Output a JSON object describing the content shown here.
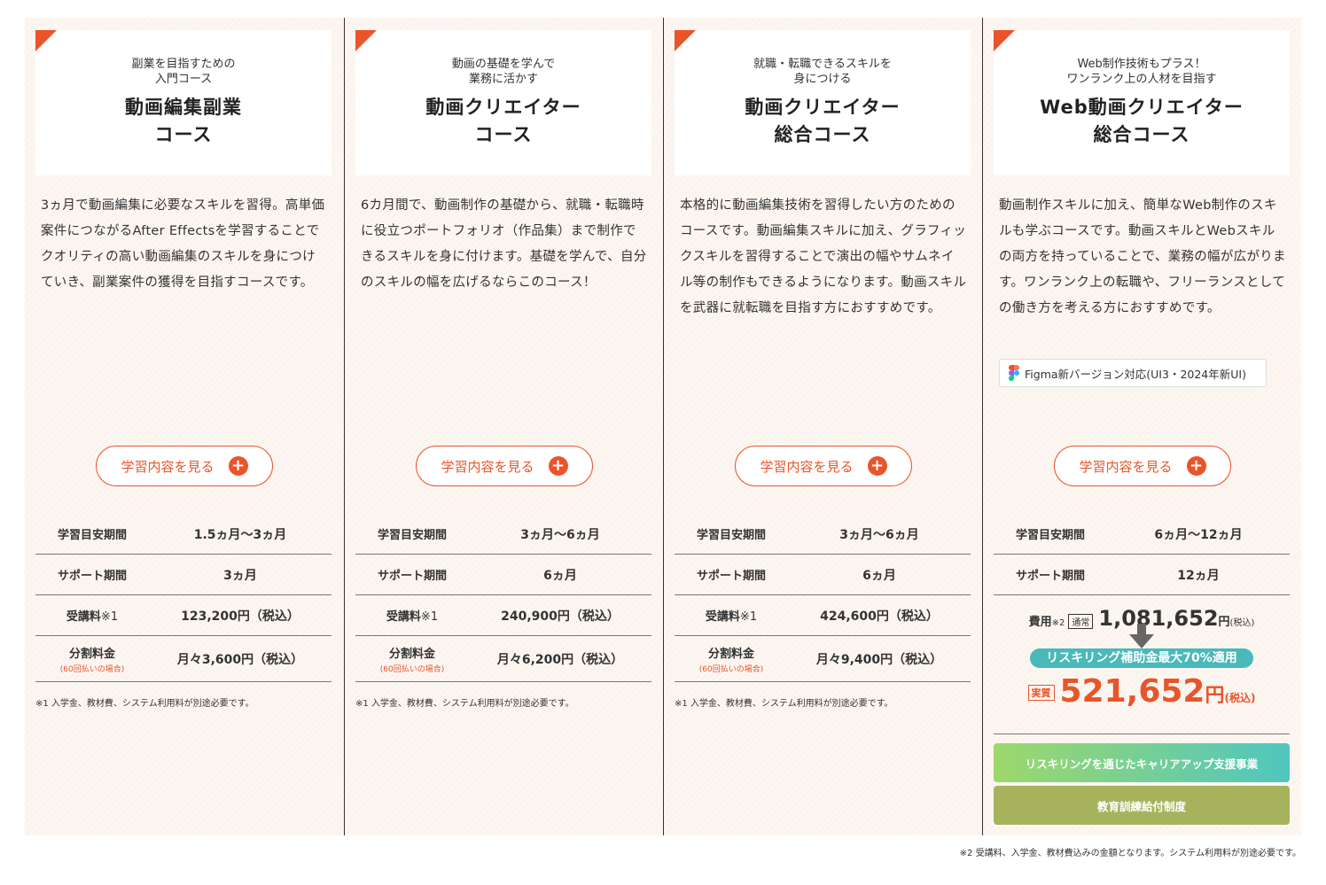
{
  "courses": [
    {
      "subtitle": "副業を目指すための\n入門コース",
      "title": "動画編集副業\nコース",
      "description": "3ヵ月で動画編集に必要なスキルを習得。高単価案件につながるAfter Effectsを学習することでクオリティの高い動画編集のスキルを身につけていき、副業案件の獲得を目指すコースです。",
      "button_label": "学習内容を見る",
      "period_label": "学習目安期間",
      "period_value": "1.5ヵ月〜3ヵ月",
      "support_label": "サポート期間",
      "support_value": "3ヵ月",
      "fee_label": "受講料",
      "fee_mark": "※1",
      "fee_value": "123,200円（税込）",
      "installment_label": "分割料金",
      "installment_note": "(60回払いの場合)",
      "installment_value": "月々3,600円（税込）",
      "note": "※1 入学金、教材費、システム利用料が別途必要です。"
    },
    {
      "subtitle": "動画の基礎を学んで\n業務に活かす",
      "title": "動画クリエイター\nコース",
      "description": "6カ月間で、動画制作の基礎から、就職・転職時に役立つポートフォリオ（作品集）まで制作できるスキルを身に付けます。基礎を学んで、自分のスキルの幅を広げるならこのコース！",
      "button_label": "学習内容を見る",
      "period_label": "学習目安期間",
      "period_value": "3ヵ月〜6ヵ月",
      "support_label": "サポート期間",
      "support_value": "6ヵ月",
      "fee_label": "受講料",
      "fee_mark": "※1",
      "fee_value": "240,900円（税込）",
      "installment_label": "分割料金",
      "installment_note": "(60回払いの場合)",
      "installment_value": "月々6,200円（税込）",
      "note": "※1 入学金、教材費、システム利用料が別途必要です。"
    },
    {
      "subtitle": "就職・転職できるスキルを\n身につける",
      "title": "動画クリエイター\n総合コース",
      "description": "本格的に動画編集技術を習得したい方のためのコースです。動画編集スキルに加え、グラフィックスキルを習得することで演出の幅やサムネイル等の制作もできるようになります。動画スキルを武器に就転職を目指す方におすすめです。",
      "button_label": "学習内容を見る",
      "period_label": "学習目安期間",
      "period_value": "3ヵ月〜6ヵ月",
      "support_label": "サポート期間",
      "support_value": "6ヵ月",
      "fee_label": "受講料",
      "fee_mark": "※1",
      "fee_value": "424,600円（税込）",
      "installment_label": "分割料金",
      "installment_note": "(60回払いの場合)",
      "installment_value": "月々9,400円（税込）",
      "note": "※1 入学金、教材費、システム利用料が別途必要です。"
    },
    {
      "subtitle": "Web制作技術もプラス！\nワンランク上の人材を目指す",
      "title": "Web動画クリエイター\n総合コース",
      "description": "動画制作スキルに加え、簡単なWeb制作のスキルも学ぶコースです。動画スキルとWebスキルの両方を持っていることで、業務の幅が広がります。ワンランク上の転職や、フリーランスとしての働き方を考える方におすすめです。",
      "tag": "Figma新バージョン対応(UI3・2024年新UI)",
      "button_label": "学習内容を見る",
      "period_label": "学習目安期間",
      "period_value": "6ヵ月〜12ヵ月",
      "support_label": "サポート期間",
      "support_value": "12ヵ月",
      "price": {
        "label": "費用",
        "mark": "※2",
        "normal_badge": "通常",
        "normal_value": "1,081,652",
        "yen": "円",
        "tax": "(税込)",
        "pill": "リスキリング補助金最大70%適用",
        "actual_badge": "実質",
        "actual_value": "521,652",
        "actual_yen": "円",
        "actual_tax": "(税込)"
      },
      "button_reskilling": "リスキリングを通じたキャリアアップ支援事業",
      "button_training": "教育訓練給付制度"
    }
  ],
  "footnote": "※2 受講料、入学金、教材費込みの金額となります。システム利用料が別途必要です。",
  "colors": {
    "accent": "#e9542a",
    "teal": "#49b9b9",
    "olive": "#a6b35c"
  }
}
